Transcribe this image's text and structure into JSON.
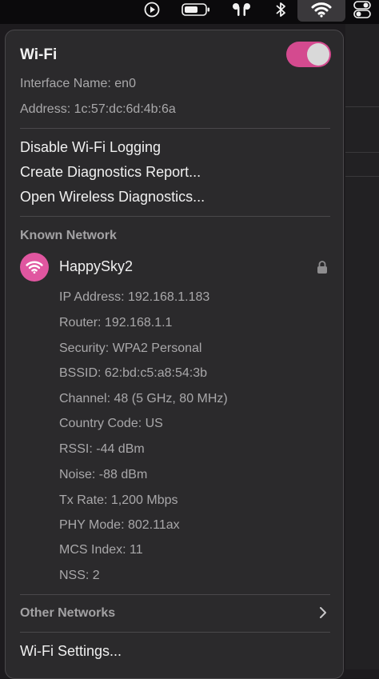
{
  "menubar": {
    "icons": [
      "play-circle-icon",
      "battery-icon",
      "airpods-icon",
      "bluetooth-icon",
      "wifi-icon",
      "control-center-icon"
    ]
  },
  "wifi": {
    "title": "Wi-Fi",
    "enabled": true,
    "interface_name": "Interface Name: en0",
    "address": "Address: 1c:57:dc:6d:4b:6a"
  },
  "actions": [
    "Disable Wi-Fi Logging",
    "Create Diagnostics Report...",
    "Open Wireless Diagnostics..."
  ],
  "known_network": {
    "section_label": "Known Network",
    "name": "HappySky2",
    "details": [
      "IP Address: 192.168.1.183",
      "Router: 192.168.1.1",
      "Security: WPA2 Personal",
      "BSSID: 62:bd:c5:a8:54:3b",
      "Channel: 48 (5 GHz, 80 MHz)",
      "Country Code: US",
      "RSSI: -44 dBm",
      "Noise: -88 dBm",
      "Tx Rate: 1,200 Mbps",
      "PHY Mode: 802.11ax",
      "MCS Index: 11",
      "NSS: 2"
    ]
  },
  "other_networks": {
    "label": "Other Networks"
  },
  "settings": {
    "label": "Wi-Fi Settings..."
  },
  "colors": {
    "accent": "#e056a0",
    "toggle_on": "#d44a8f",
    "panel_bg": "#2b2a2c"
  }
}
